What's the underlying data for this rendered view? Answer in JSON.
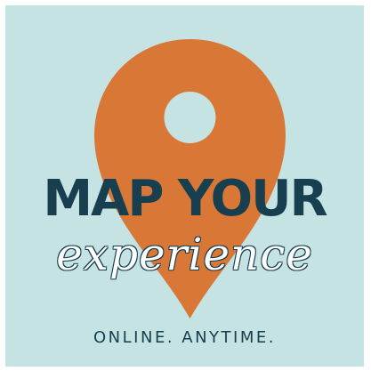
{
  "colors": {
    "background": "#c5e3e2",
    "pin": "#d97736",
    "headline": "#173f4f",
    "script": "#ffffff"
  },
  "graphic": {
    "icon": "map-pin-icon"
  },
  "text": {
    "headline": "MAP YOUR",
    "script": "experience",
    "tagline": "ONLINE. ANYTIME."
  }
}
